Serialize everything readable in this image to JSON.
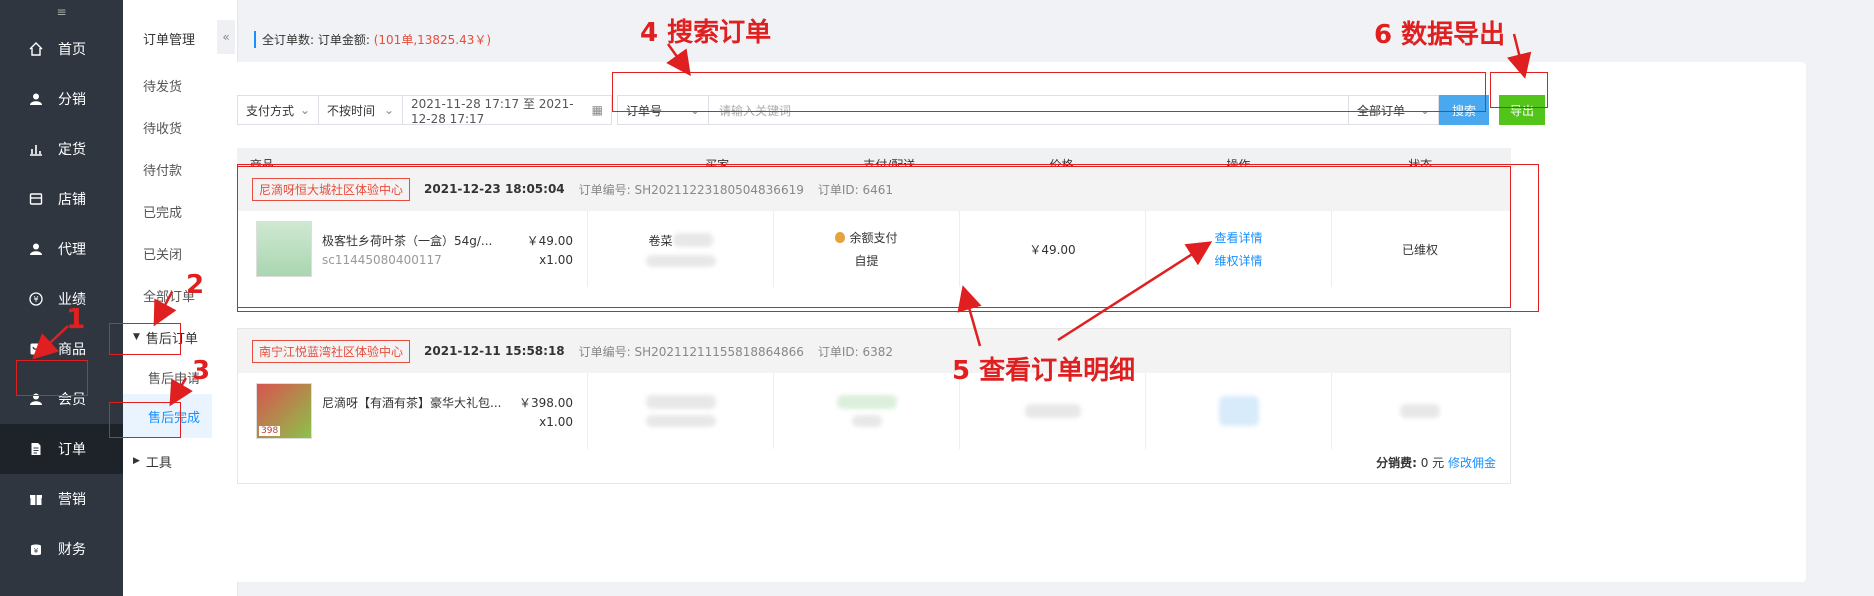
{
  "sidebar": {
    "collapse_icon": "≡",
    "items": [
      {
        "label": "首页",
        "icon": "home-icon"
      },
      {
        "label": "分销",
        "icon": "user-icon"
      },
      {
        "label": "定货",
        "icon": "chart-icon"
      },
      {
        "label": "店铺",
        "icon": "store-icon"
      },
      {
        "label": "代理",
        "icon": "user-icon"
      },
      {
        "label": "业绩",
        "icon": "yen-icon"
      },
      {
        "label": "商品",
        "icon": "goods-icon"
      },
      {
        "label": "会员",
        "icon": "user-icon"
      },
      {
        "label": "订单",
        "icon": "document-icon"
      },
      {
        "label": "营销",
        "icon": "gift-icon"
      },
      {
        "label": "财务",
        "icon": "wallet-icon"
      }
    ],
    "active": "订单"
  },
  "subbar": {
    "title": "订单管理",
    "fold_icon": "«",
    "items": [
      "待发货",
      "待收货",
      "待付款",
      "已完成",
      "已关闭",
      "全部订单"
    ],
    "group_aftersale": "售后订单",
    "aftersale_items": [
      "售后申请",
      "售后完成"
    ],
    "group_tools": "工具",
    "active": "售后完成"
  },
  "summary": {
    "label": "全订单数: 订单金额:",
    "value": "(101单,13825.43￥)"
  },
  "filters": {
    "pay_method": "支付方式",
    "time_mode": "不按时间",
    "date_range": "2021-11-28 17:17 至 2021-12-28 17:17",
    "search_field": "订单号",
    "keyword_placeholder": "请输入关键词",
    "order_scope": "全部订单",
    "search_button": "搜索",
    "export_button": "导出"
  },
  "table": {
    "headers": [
      "商品",
      "买家",
      "支付/配送",
      "价格",
      "操作",
      "状态"
    ]
  },
  "orders": [
    {
      "shop": "尼滴呀恒大城社区体验中心",
      "date": "2021-12-23  18:05:04",
      "order_no": "订单编号: SH20211223180504836619",
      "order_id": "订单ID: 6461",
      "product_name": "极客牡乡荷叶茶（一盒）54g/...",
      "sku": "sc11445080400117",
      "unit_price": "￥49.00",
      "qty": "x1.00",
      "buyer": "卷菜 ",
      "pay": "余额支付",
      "delivery": "自提",
      "price": "￥49.00",
      "op1": "查看详情",
      "op2": "维权详情",
      "status": "已维权"
    },
    {
      "shop": "南宁江悦蓝湾社区体验中心",
      "date": "2021-12-11  15:58:18",
      "order_no": "订单编号: SH20211211155818864866",
      "order_id": "订单ID: 6382",
      "product_name": "尼滴呀【有酒有茶】豪华大礼包...",
      "unit_price": "￥398.00",
      "qty": "x1.00",
      "thumb_badge": "398",
      "commission_label": "分销费:",
      "commission_value": "0 元",
      "commission_link": "修改佣金"
    }
  ],
  "annotations": {
    "a1": "1",
    "a2": "2",
    "a3": "3",
    "a4": "4 搜索订单",
    "a5": "5 查看订单明细",
    "a6": "6 数据导出"
  },
  "colors": {
    "sidebar_bg": "#2f3640",
    "accent_blue": "#1890ff",
    "annotation_red": "#e02020",
    "export_green": "#52c41a"
  }
}
